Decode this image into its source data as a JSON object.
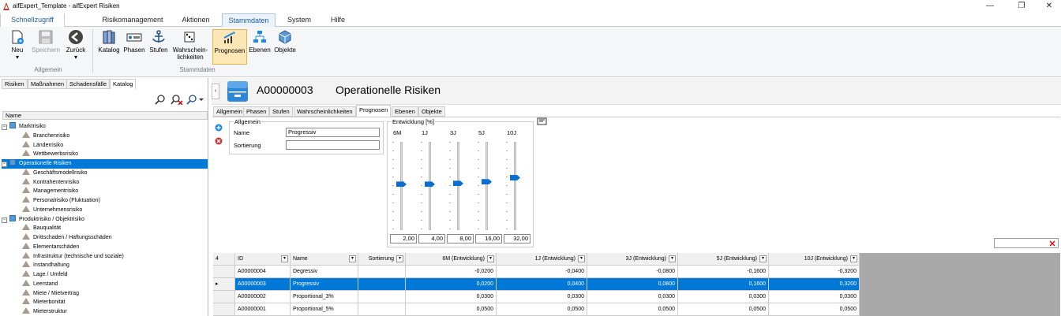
{
  "window": {
    "title": "aifExpert_Template - aifExpert Risiken",
    "minimize": "—",
    "restore": "❐",
    "close": "✕"
  },
  "ribbon_tabs": {
    "quick": "Schnellzugriff",
    "t1": "Risikomanagement",
    "t2": "Aktionen",
    "t3": "Stammdaten",
    "t4": "System",
    "t5": "Hilfe"
  },
  "ribbon": {
    "neu": "Neu",
    "speichern": "Speichern",
    "zurueck": "Zurück",
    "group_allgemein": "Allgemein",
    "katalog": "Katalog",
    "phasen": "Phasen",
    "stufen": "Stufen",
    "wahr1": "Wahrschein-",
    "wahr2": "lichkeiten",
    "prognosen": "Prognosen",
    "ebenen": "Ebenen",
    "objekte": "Objekte",
    "group_stammdaten": "Stammdaten"
  },
  "left_tabs": {
    "t1": "Risiken",
    "t2": "Maßnahmen",
    "t3": "Schadensfälle",
    "t4": "Katalog"
  },
  "tree": {
    "header": "Name",
    "nodes": [
      {
        "label": "Marktrisiko",
        "level": 0,
        "type": "group"
      },
      {
        "label": "Branchenrisiko",
        "level": 1,
        "type": "item"
      },
      {
        "label": "Länderrisiko",
        "level": 1,
        "type": "item"
      },
      {
        "label": "Wettbewerbsrisiko",
        "level": 1,
        "type": "item"
      },
      {
        "label": "Operationelle Risiken",
        "level": 0,
        "type": "group",
        "selected": true
      },
      {
        "label": "Geschäftsmodellrisiko",
        "level": 1,
        "type": "item"
      },
      {
        "label": "Kontrahentenrisiko",
        "level": 1,
        "type": "item"
      },
      {
        "label": "Managementrisiko",
        "level": 1,
        "type": "item"
      },
      {
        "label": "Personalrisiko (Fluktuation)",
        "level": 1,
        "type": "item"
      },
      {
        "label": "Unternehmensrisiko",
        "level": 1,
        "type": "item"
      },
      {
        "label": "Produktrisiko / Objektrisiko",
        "level": 0,
        "type": "group"
      },
      {
        "label": "Bauqualität",
        "level": 1,
        "type": "item"
      },
      {
        "label": "Drittschaden / Haftungsschäden",
        "level": 1,
        "type": "item"
      },
      {
        "label": "Elementarschäden",
        "level": 1,
        "type": "item"
      },
      {
        "label": "Infrastruktur (technische und soziale)",
        "level": 1,
        "type": "item"
      },
      {
        "label": "Instandhaltung",
        "level": 1,
        "type": "item"
      },
      {
        "label": "Lage / Umfeld",
        "level": 1,
        "type": "item"
      },
      {
        "label": "Leerstand",
        "level": 1,
        "type": "item"
      },
      {
        "label": "Miete / Mietvertrag",
        "level": 1,
        "type": "item"
      },
      {
        "label": "Mieterbonität",
        "level": 1,
        "type": "item"
      },
      {
        "label": "Mieterstruktur",
        "level": 1,
        "type": "item"
      }
    ]
  },
  "detail": {
    "code": "A00000003",
    "name": "Operationelle Risiken"
  },
  "detail_tabs": {
    "t1": "Allgemein",
    "t2": "Phasen",
    "t3": "Stufen",
    "t4": "Wahrscheinlichkeiten",
    "t5": "Prognosen",
    "t6": "Ebenen",
    "t7": "Objekte"
  },
  "form": {
    "group_allgemein": "Allgemein",
    "name_label": "Name",
    "name_value": "Progressiv",
    "sort_label": "Sortierung",
    "sort_value": "",
    "group_entwicklung": "Entwicklung [%]"
  },
  "sliders": [
    {
      "label": "6M",
      "value": "2,00",
      "level": 0.52
    },
    {
      "label": "1J",
      "value": "4,00",
      "level": 0.52
    },
    {
      "label": "3J",
      "value": "8,00",
      "level": 0.53
    },
    {
      "label": "5J",
      "value": "16,00",
      "level": 0.55
    },
    {
      "label": "10J",
      "value": "32,00",
      "level": 0.6
    }
  ],
  "grid": {
    "corner": "4",
    "columns": [
      "ID",
      "Name",
      "Sortierung",
      "6M (Entwicklung)",
      "1J (Entwicklung)",
      "3J (Entwicklung)",
      "5J (Entwicklung)",
      "10J (Entwicklung)"
    ],
    "rows": [
      {
        "id": "A00000004",
        "name": "Degressiv",
        "sort": "",
        "v": [
          "-0,0200",
          "-0,0400",
          "-0,0800",
          "-0,1600",
          "-0,3200"
        ],
        "selected": false
      },
      {
        "id": "A00000003",
        "name": "Progressiv",
        "sort": "",
        "v": [
          "0,0200",
          "0,0400",
          "0,0800",
          "0,1600",
          "0,3200"
        ],
        "selected": true
      },
      {
        "id": "A00000002",
        "name": "Proportional_3%",
        "sort": "",
        "v": [
          "0,0300",
          "0,0300",
          "0,0300",
          "0,0300",
          "0,0300"
        ],
        "selected": false
      },
      {
        "id": "A00000001",
        "name": "Proportional_5%",
        "sort": "",
        "v": [
          "0,0500",
          "0,0500",
          "0,0500",
          "0,0500",
          "0,0500"
        ],
        "selected": false
      }
    ]
  },
  "colors": {
    "accent": "#0078d7",
    "ribbon_sel": "#fde7b7"
  }
}
